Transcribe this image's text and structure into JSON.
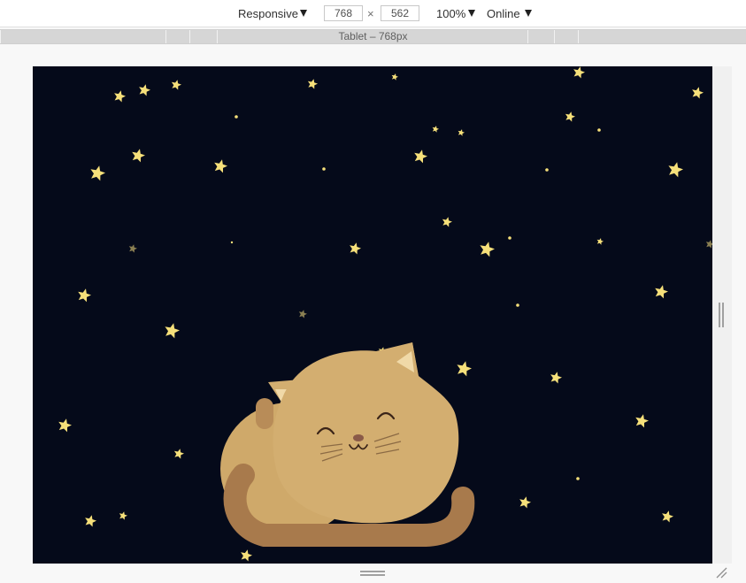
{
  "toolbar": {
    "device_label": "Responsive",
    "width_value": "768",
    "times_symbol": "×",
    "height_value": "562",
    "zoom_label": "100%",
    "throttle_label": "Online"
  },
  "ruler": {
    "label": "Tablet – 768px"
  },
  "colors": {
    "toolbar_bg": "#ffffff",
    "ruler_bg": "#d6d6d6",
    "page_bg": "#f8f8f8",
    "sky": "#050a1a",
    "star": "#f6e07a",
    "star_dim": "#8a7f52",
    "cat_body": "#d3ae70",
    "cat_shadow": "#c19a5c",
    "cat_tail": "#a87a4c",
    "cat_ear_inner": "#f0d9a8",
    "cat_face": "#4a2d20"
  },
  "icons": {
    "device_caret": "caret-down-icon",
    "zoom_caret": "caret-down-icon",
    "throttle_caret": "caret-down-icon",
    "resize_right": "resize-handle-vertical-icon",
    "resize_bottom": "resize-handle-horizontal-icon",
    "resize_corner": "resize-corner-icon"
  },
  "illustration": {
    "subject": "sleeping-cat",
    "background": "starry-night"
  }
}
